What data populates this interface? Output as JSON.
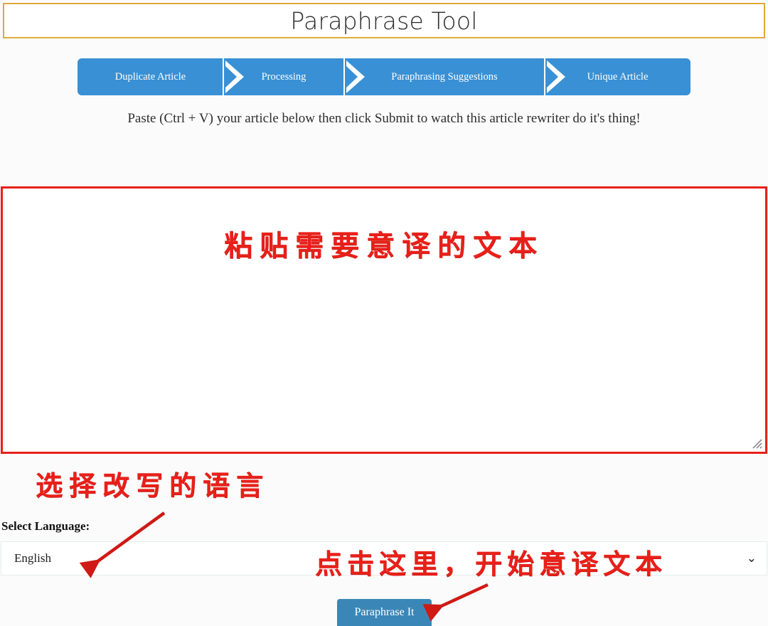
{
  "page": {
    "title": "Paraphrase Tool",
    "background_color": "#fbfbfb"
  },
  "header": {
    "title": "Paraphrase Tool",
    "border_color": "#e0a93c"
  },
  "steps": {
    "accent_color": "#3990d4",
    "items": [
      {
        "label": "Duplicate Article"
      },
      {
        "label": "Processing"
      },
      {
        "label": "Paraphrasing Suggestions"
      },
      {
        "label": "Unique Article"
      }
    ]
  },
  "instruction": {
    "text": "Paste (Ctrl + V) your article below then click Submit to watch this article rewriter do it's thing!"
  },
  "paste_area": {
    "value": "",
    "placeholder": "",
    "border_color": "#e8201a",
    "resize_handle_icon": "resize-grip-icon"
  },
  "annotations": {
    "color": "#e8201a",
    "paste_text": "粘贴需要意译的文本",
    "select_language_text": "选择改写的语言",
    "click_here_text": "点击这里，开始意译文本"
  },
  "language_select": {
    "label": "Select Language:",
    "selected": "English",
    "caret_icon": "chevron-down-icon",
    "options": [
      "English"
    ]
  },
  "submit": {
    "label": "Paraphrase It",
    "color": "#3a87b7"
  }
}
